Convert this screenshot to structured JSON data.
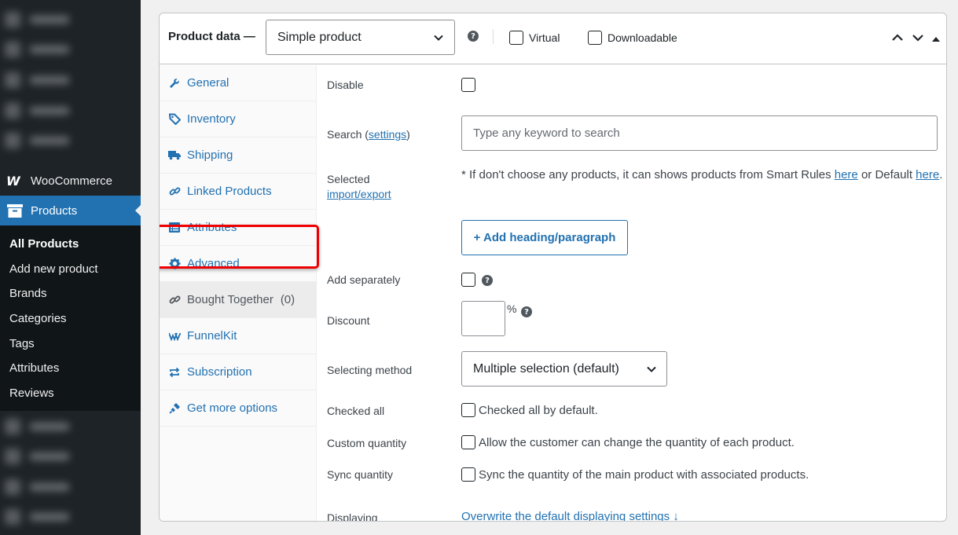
{
  "sidebar": {
    "woocommerce_label": "WooCommerce",
    "woocommerce_logo": "W",
    "products_label": "Products",
    "submenu": [
      "All Products",
      "Add new product",
      "Brands",
      "Categories",
      "Tags",
      "Attributes",
      "Reviews"
    ],
    "current_item": "All Products",
    "accent_color": "#2271b1"
  },
  "header": {
    "title": "Product data —",
    "product_type": "Simple product",
    "help_icon": "?",
    "virtual_label": "Virtual",
    "downloadable_label": "Downloadable"
  },
  "tabs": [
    {
      "label": "General",
      "icon": "wrench-icon"
    },
    {
      "label": "Inventory",
      "icon": "tag-icon"
    },
    {
      "label": "Shipping",
      "icon": "truck-icon"
    },
    {
      "label": "Linked Products",
      "icon": "link-icon"
    },
    {
      "label": "Attributes",
      "icon": "list-icon"
    },
    {
      "label": "Advanced",
      "icon": "gear-icon"
    },
    {
      "label": "Bought Together",
      "count": "(0)",
      "icon": "link-icon"
    },
    {
      "label": "FunnelKit",
      "icon": "funnelkit-icon"
    },
    {
      "label": "Subscription",
      "icon": "repeat-icon"
    },
    {
      "label": "Get more options",
      "icon": "plugin-icon"
    }
  ],
  "form": {
    "disable_label": "Disable",
    "search_label": "Search (",
    "search_settings_link": "settings",
    "search_label_end": ")",
    "search_placeholder": "Type any keyword to search",
    "selected_label": "Selected",
    "import_export_link": "import/export",
    "hint_prefix": "* If don't choose any products, it can shows products from Smart Rules ",
    "hint_here1": "here",
    "hint_middle": " or Default ",
    "hint_here2": "here",
    "hint_end": ".",
    "add_heading_button": "+ Add heading/paragraph",
    "add_separately_label": "Add separately",
    "discount_label": "Discount",
    "discount_suffix": "%",
    "selecting_method_label": "Selecting method",
    "selecting_method_value": "Multiple selection (default)",
    "checked_all_label": "Checked all",
    "checked_all_text": "Checked all by default.",
    "custom_quantity_label": "Custom quantity",
    "custom_quantity_text": "Allow the customer can change the quantity of each product.",
    "sync_quantity_label": "Sync quantity",
    "sync_quantity_text": "Sync the quantity of the main product with associated products.",
    "displaying_label": "Displaying",
    "displaying_link": "Overwrite the default displaying settings ↓"
  }
}
